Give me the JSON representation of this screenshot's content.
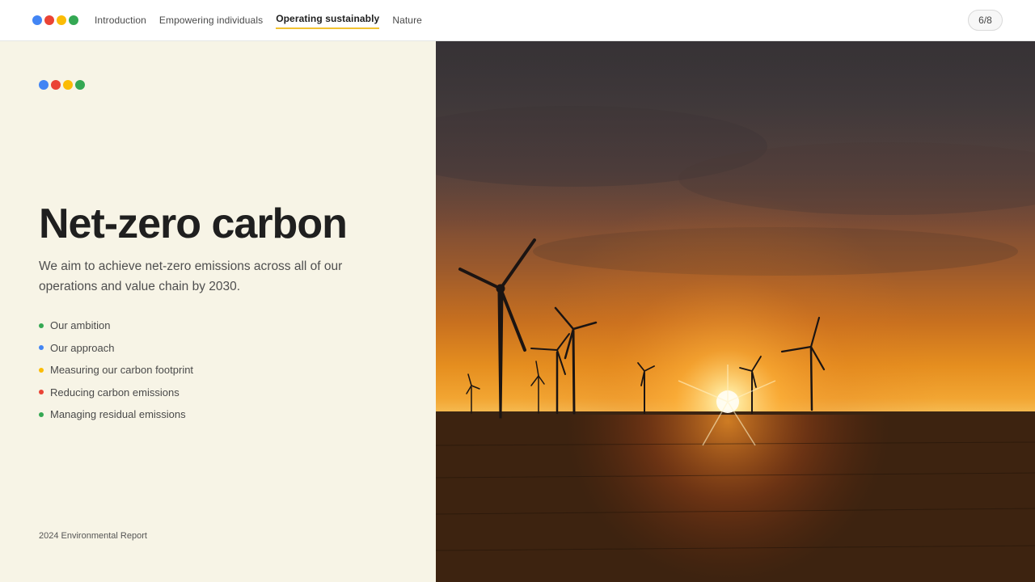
{
  "brand": {
    "dot_colors": [
      "#4285F4",
      "#EA4335",
      "#FBBC05",
      "#34A853"
    ]
  },
  "nav": {
    "items": [
      "Introduction",
      "Empowering individuals",
      "Operating sustainably",
      "Nature"
    ],
    "active_index": 2
  },
  "page_indicator": "6/8",
  "main": {
    "title": "Net-zero carbon",
    "subtitle": "We aim to achieve net-zero emissions across all of our operations and value chain by 2030.",
    "bullets": [
      {
        "label": "Our ambition",
        "color": "#34A853"
      },
      {
        "label": "Our approach",
        "color": "#4285F4"
      },
      {
        "label": "Measuring our carbon footprint",
        "color": "#FBBC05"
      },
      {
        "label": "Reducing carbon emissions",
        "color": "#EA4335"
      },
      {
        "label": "Managing residual emissions",
        "color": "#34A853"
      }
    ]
  },
  "footer": "2024 Environmental Report"
}
